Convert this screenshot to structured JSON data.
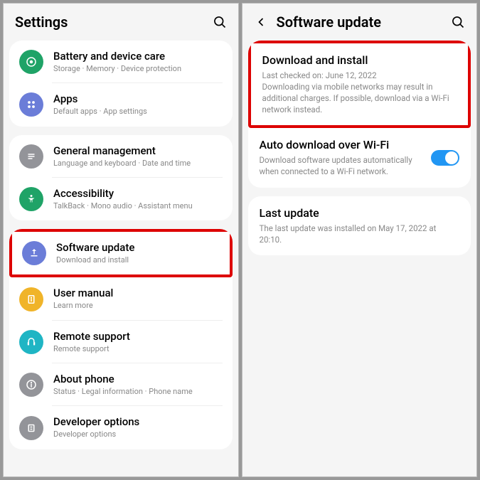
{
  "left": {
    "title": "Settings",
    "items": [
      {
        "title": "Battery and device care",
        "sub": "Storage · Memory · Device protection"
      },
      {
        "title": "Apps",
        "sub": "Default apps · App settings"
      },
      {
        "title": "General management",
        "sub": "Language and keyboard · Date and time"
      },
      {
        "title": "Accessibility",
        "sub": "TalkBack · Mono audio · Assistant menu"
      },
      {
        "title": "Software update",
        "sub": "Download and install"
      },
      {
        "title": "User manual",
        "sub": "Learn more"
      },
      {
        "title": "Remote support",
        "sub": "Remote support"
      },
      {
        "title": "About phone",
        "sub": "Status · Legal information · Phone name"
      },
      {
        "title": "Developer options",
        "sub": "Developer options"
      }
    ]
  },
  "right": {
    "title": "Software update",
    "download": {
      "title": "Download and install",
      "line1": "Last checked on: June 12, 2022",
      "line2": "Downloading via mobile networks may result in additional charges. If possible, download via a Wi-Fi network instead."
    },
    "auto": {
      "title": "Auto download over Wi-Fi",
      "sub": "Download software updates automatically when connected to a Wi-Fi network."
    },
    "last": {
      "title": "Last update",
      "sub": "The last update was installed on May 17, 2022 at 20:10."
    }
  }
}
